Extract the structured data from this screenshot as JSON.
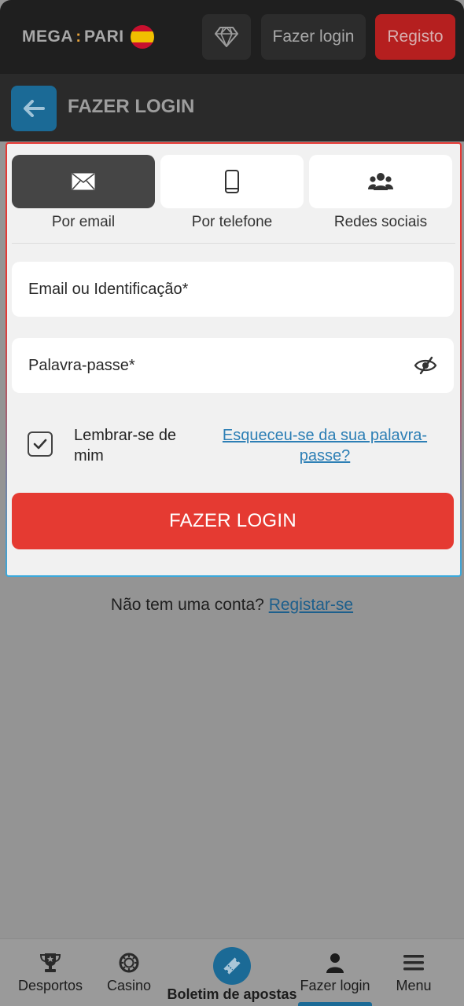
{
  "header": {
    "logo": {
      "left": "MEGA",
      "sep": ":",
      "right": "PARI",
      "flag": "spain-flag"
    },
    "diamond_icon": "diamond-icon",
    "login_label": "Fazer login",
    "register_label": "Registo"
  },
  "subheader": {
    "back_icon": "arrow-left-icon",
    "title": "FAZER LOGIN"
  },
  "login_form": {
    "tabs": [
      {
        "label": "Por email",
        "icon": "envelope-icon",
        "active": true
      },
      {
        "label": "Por telefone",
        "icon": "smartphone-icon",
        "active": false
      },
      {
        "label": "Redes sociais",
        "icon": "users-icon",
        "active": false
      }
    ],
    "email_placeholder": "Email ou Identificação*",
    "email_value": "",
    "password_placeholder": "Palavra-passe*",
    "password_value": "",
    "remember_label": "Lembrar-se de mim",
    "remember_checked": true,
    "forgot_label": "Esqueceu-se da sua palavra-passe?",
    "submit_label": "FAZER LOGIN"
  },
  "register_prompt": {
    "text": "Não tem uma conta?",
    "link": "Registar-se"
  },
  "bottom_nav": {
    "items": [
      {
        "label": "Desportos",
        "icon": "trophy-icon"
      },
      {
        "label": "Casino",
        "icon": "casino-chip-icon"
      },
      {
        "label": "Boletim de apostas",
        "icon": "ticket-icon"
      },
      {
        "label": "Fazer login",
        "icon": "user-icon",
        "active": true
      },
      {
        "label": "Menu",
        "icon": "hamburger-icon"
      }
    ]
  },
  "colors": {
    "accent_red": "#e53a32",
    "accent_blue": "#1b6a96",
    "link_blue": "#2d7fb5"
  }
}
